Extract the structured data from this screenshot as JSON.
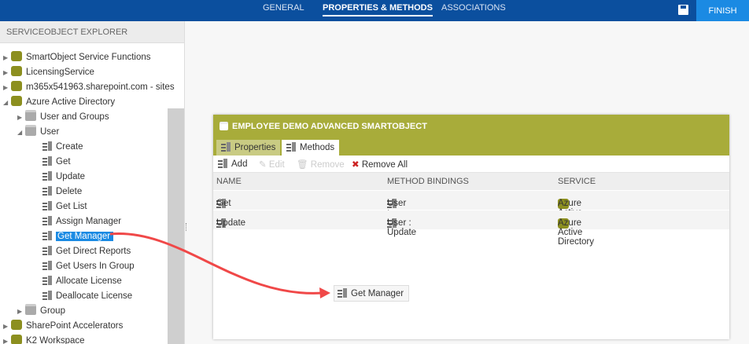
{
  "topnav": {
    "tabs": [
      "GENERAL",
      "PROPERTIES & METHODS",
      "ASSOCIATIONS"
    ],
    "active": "PROPERTIES & METHODS",
    "finish": "FINISH"
  },
  "explorer": {
    "title": "SERVICEOBJECT EXPLORER",
    "items": [
      "SmartObject Service Functions",
      "LicensingService",
      "m365x541963.sharepoint.com - sites",
      "Azure Active Directory",
      "User and Groups",
      "User",
      "Create",
      "Get",
      "Update",
      "Delete",
      "Get List",
      "Assign Manager",
      "Get Manager",
      "Get Direct Reports",
      "Get Users In Group",
      "Allocate License",
      "Deallocate License",
      "Group",
      "SharePoint Accelerators",
      "K2 Workspace"
    ]
  },
  "smartobject": {
    "title": "EMPLOYEE DEMO ADVANCED SMARTOBJECT",
    "tabs": [
      "Properties",
      "Methods"
    ],
    "toolbar": {
      "add": "Add",
      "edit": "Edit",
      "remove": "Remove",
      "remove_all": "Remove All"
    },
    "columns": [
      "NAME",
      "METHOD BINDINGS",
      "SERVICE"
    ],
    "rows": [
      {
        "name": "Get",
        "binding": "User : Get",
        "service": "Azure Active Directory"
      },
      {
        "name": "Update",
        "binding": "User : Update",
        "service": "Azure Active Directory"
      }
    ]
  },
  "drag_chip": "Get Manager",
  "colors": {
    "topbar": "#0b4f9e",
    "accent": "#1b8ae3",
    "olive": "#a8ac3a",
    "arrow": "#f04848"
  }
}
